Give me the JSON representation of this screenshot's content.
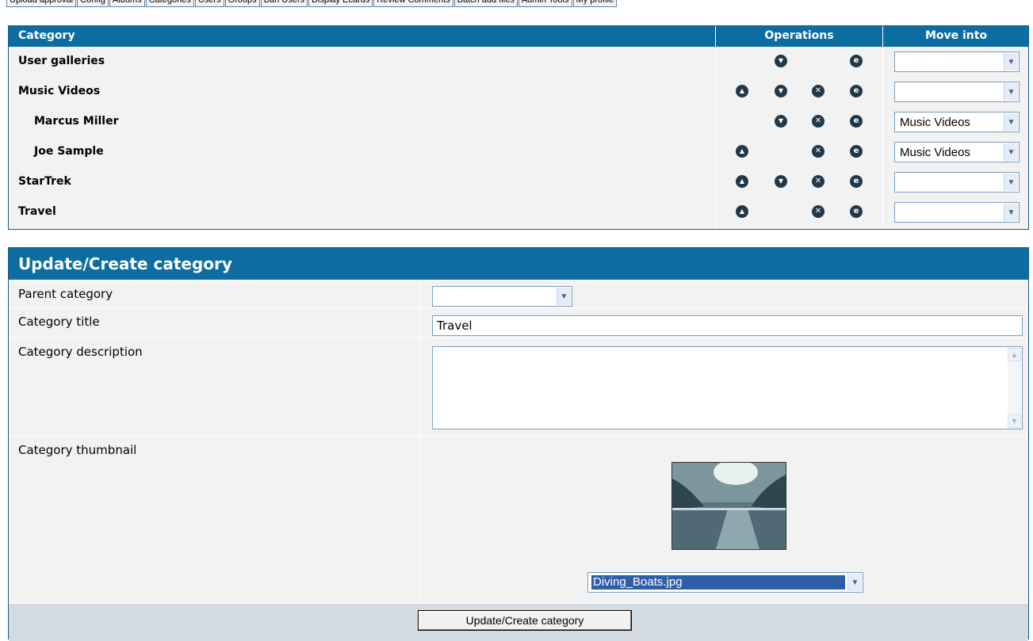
{
  "admin_menu": [
    "Upload approval",
    "Config",
    "Albums",
    "Categories",
    "Users",
    "Groups",
    "Ban Users",
    "Display Ecards",
    "Review Comments",
    "Batch add files",
    "Admin Tools",
    "My profile"
  ],
  "category_table": {
    "headers": {
      "category": "Category",
      "operations": "Operations",
      "move_into": "Move into"
    },
    "rows": [
      {
        "name": "User galleries",
        "indent": false,
        "up": false,
        "down": true,
        "delete": false,
        "edit": true,
        "move_into": ""
      },
      {
        "name": "Music Videos",
        "indent": false,
        "up": true,
        "down": true,
        "delete": true,
        "edit": true,
        "move_into": ""
      },
      {
        "name": "Marcus Miller",
        "indent": true,
        "up": false,
        "down": true,
        "delete": true,
        "edit": true,
        "move_into": "Music Videos"
      },
      {
        "name": "Joe Sample",
        "indent": true,
        "up": true,
        "down": false,
        "delete": true,
        "edit": true,
        "move_into": "Music Videos"
      },
      {
        "name": "StarTrek",
        "indent": false,
        "up": true,
        "down": true,
        "delete": true,
        "edit": true,
        "move_into": ""
      },
      {
        "name": "Travel",
        "indent": false,
        "up": true,
        "down": false,
        "delete": true,
        "edit": true,
        "move_into": ""
      }
    ]
  },
  "form": {
    "title": "Update/Create category",
    "parent_label": "Parent category",
    "parent_value": "",
    "title_label": "Category title",
    "title_value": "Travel",
    "description_label": "Category description",
    "description_value": "",
    "thumbnail_label": "Category thumbnail",
    "thumbnail_file": "Diving_Boats.jpg",
    "submit_label": "Update/Create category"
  },
  "icons": {
    "up": "arrow-up-icon",
    "down": "arrow-down-icon",
    "delete": "delete-x-icon",
    "edit": "edit-e-icon"
  },
  "colors": {
    "header_bg": "#0e6da0",
    "row_bg": "#f2f2f2",
    "footer_bg": "#d4dae2",
    "icon": "#203848"
  }
}
